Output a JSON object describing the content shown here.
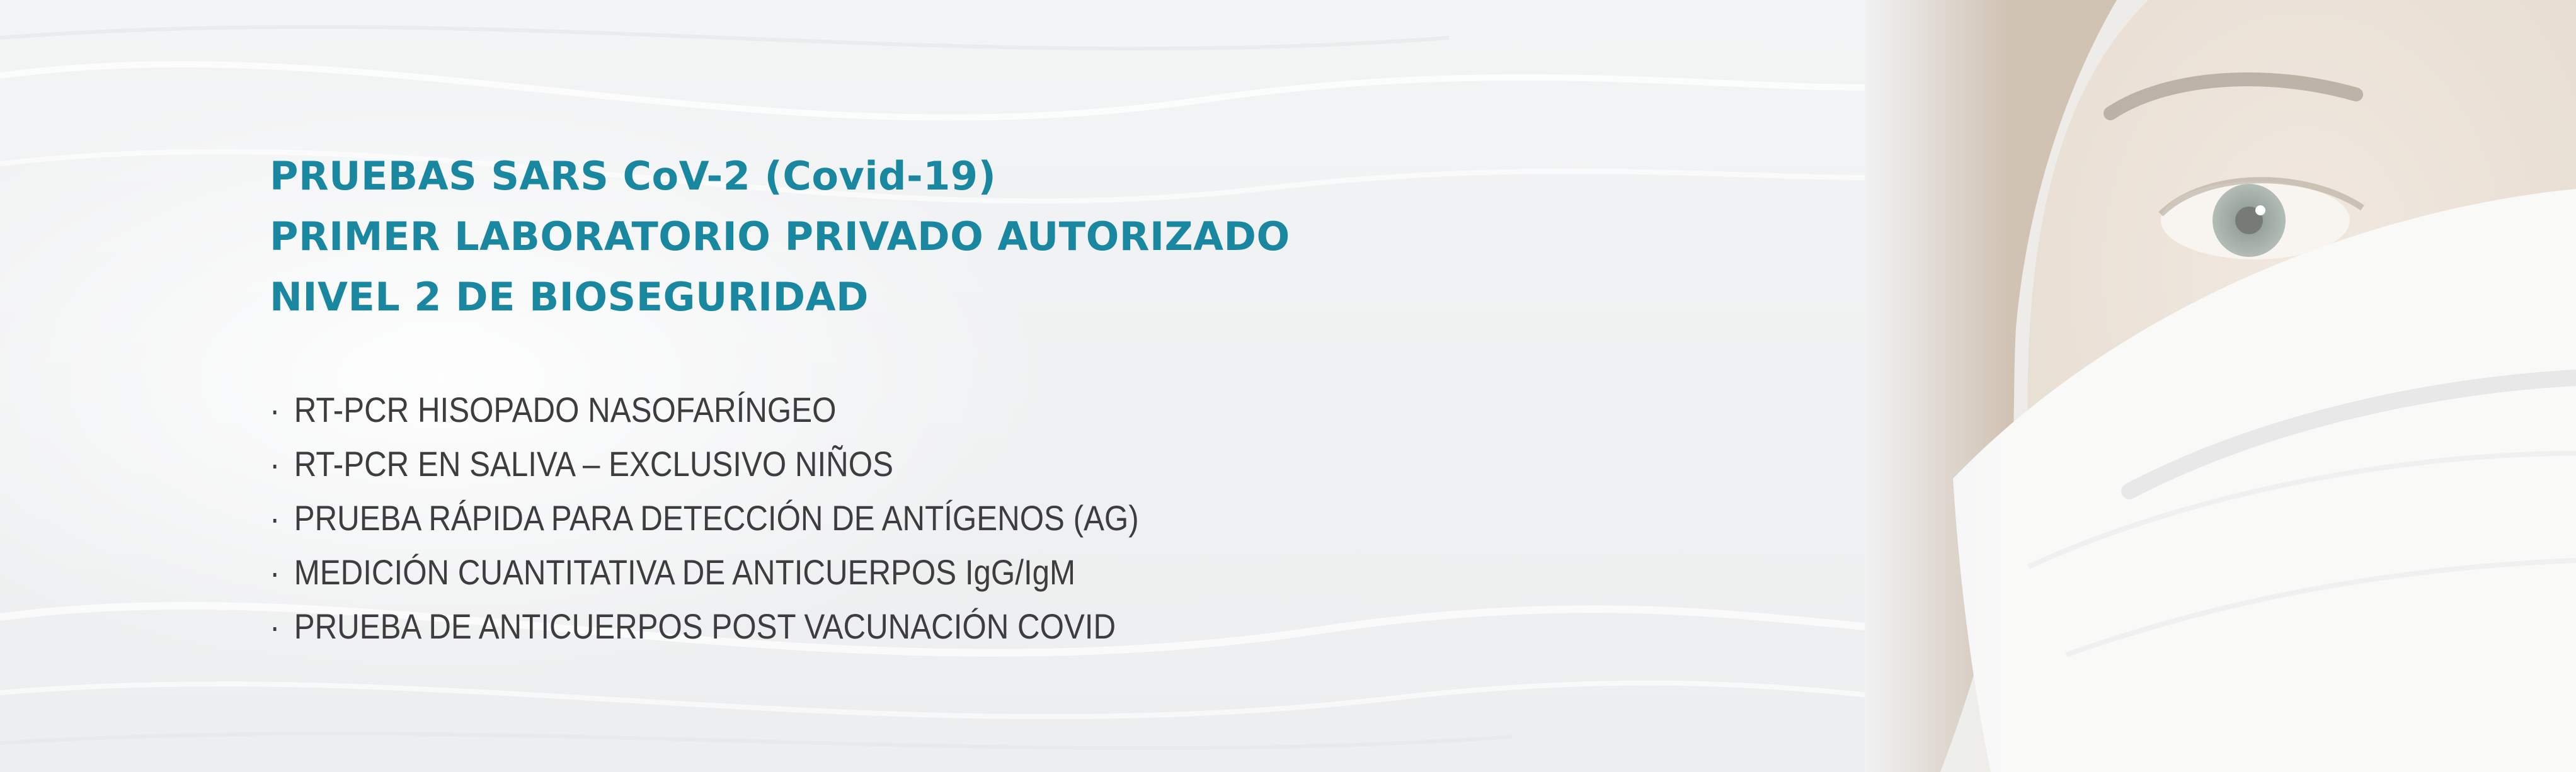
{
  "headline": {
    "line1": "PRUEBAS SARS CoV-2 (Covid-19)",
    "line2": "PRIMER LABORATORIO PRIVADO AUTORIZADO",
    "line3": "NIVEL 2 DE BIOSEGURIDAD"
  },
  "bullet_glyph": "·",
  "services": [
    "RT-PCR HISOPADO NASOFARÍNGEO",
    "RT-PCR EN SALIVA – EXCLUSIVO NIÑOS",
    "PRUEBA RÁPIDA PARA DETECCIÓN DE ANTÍGENOS (AG)",
    "MEDICIÓN CUANTITATIVA DE ANTICUERPOS IgG/IgM",
    "PRUEBA DE ANTICUERPOS POST VACUNACIÓN COVID"
  ],
  "colors": {
    "headline": "#1a87a0",
    "body_text": "#3d3d3f",
    "background": "#f1f2f3"
  }
}
